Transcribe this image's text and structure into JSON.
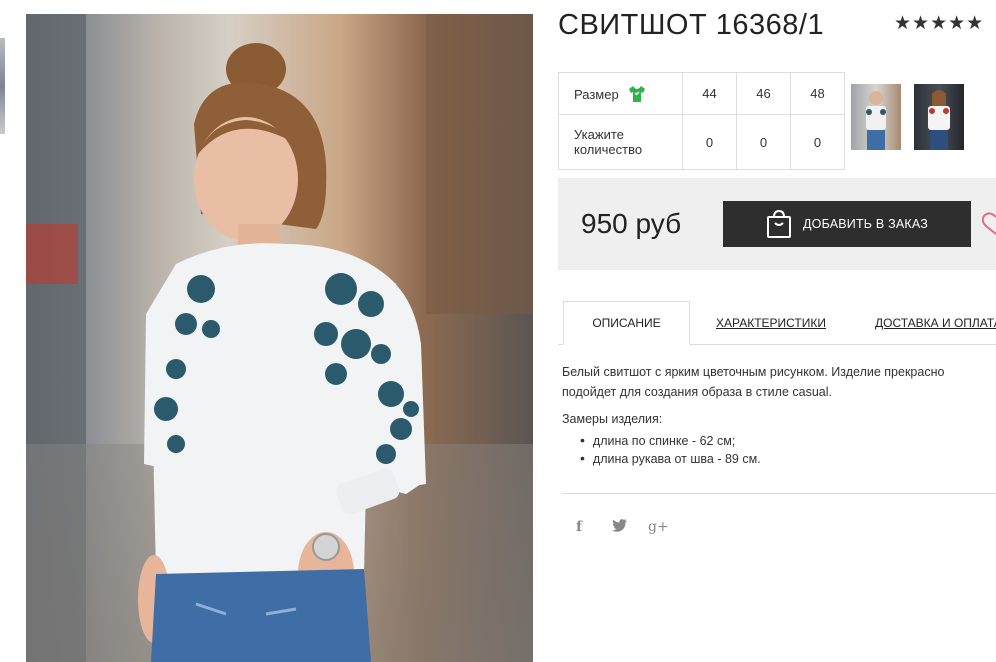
{
  "product": {
    "title": "СВИТШОТ 16368/1",
    "rating_stars": "★★★★★"
  },
  "sizes": {
    "size_label": "Размер",
    "qty_label_line1": "Укажите",
    "qty_label_line2": "количество",
    "values": [
      "44",
      "46",
      "48"
    ],
    "quantities": [
      "0",
      "0",
      "0"
    ]
  },
  "order": {
    "price": "950 руб",
    "add_button_label": "ДОБАВИТЬ В ЗАКАЗ"
  },
  "tabs": {
    "description": "ОПИСАНИЕ",
    "characteristics": "ХАРАКТЕРИСТИКИ",
    "delivery": "ДОСТАВКА И ОПЛАТА"
  },
  "description": {
    "text": "Белый свитшот с ярким цветочным рисунком. Изделие прекрасно подойдет для создания образа в стиле casual.",
    "measures_title": "Замеры изделия:",
    "measures": [
      "длина по спинке - 62 см;",
      "длина рукава от шва - 89 см."
    ]
  },
  "social": {
    "facebook": "f",
    "twitter": "t",
    "googleplus": "g+"
  },
  "colors": {
    "accent_green": "#2db34a",
    "button_dark": "#2e2e2e",
    "heart_pink": "#e36a86",
    "order_box_bg": "#efefef"
  },
  "icons": [
    "shirt-size-icon",
    "shopping-bag-icon",
    "heart-icon",
    "facebook-icon",
    "twitter-icon",
    "google-plus-icon"
  ]
}
